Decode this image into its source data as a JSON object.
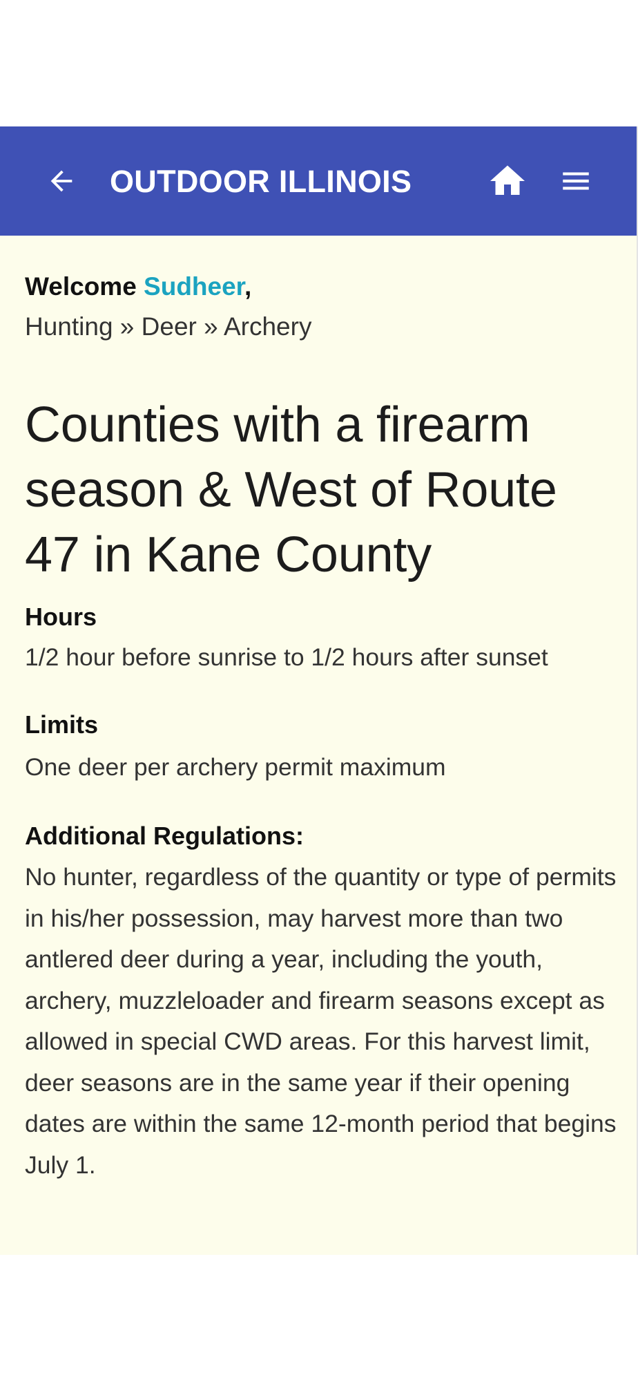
{
  "app_bar": {
    "title": "OUTDOOR ILLINOIS",
    "back_icon": "arrow-left-icon",
    "home_icon": "home-icon",
    "menu_icon": "hamburger-menu-icon",
    "background_color": "#3f51b5"
  },
  "welcome": {
    "prefix": "Welcome ",
    "name": "Sudheer",
    "suffix": ",",
    "name_color": "#1ba3c0"
  },
  "breadcrumb": {
    "items": [
      "Hunting",
      "Deer",
      "Archery"
    ],
    "separator": " » "
  },
  "page": {
    "title": "Counties with a firearm season & West of Route 47 in Kane County",
    "background_color": "#fdfdeb"
  },
  "sections": {
    "hours": {
      "heading": "Hours",
      "text": "1/2 hour before sunrise to 1/2 hours after sunset"
    },
    "limits": {
      "heading": "Limits",
      "text": "One deer per archery permit maximum"
    },
    "regulations": {
      "heading": "Additional Regulations:",
      "text": "No hunter, regardless of the quantity or type of permits in his/her possession, may harvest more than two antlered deer during a year, including the youth, archery, muzzleloader and firearm seasons except as allowed in special CWD areas. For this harvest limit, deer seasons are in the same year if their opening dates are within the same 12-month period that begins July 1."
    }
  }
}
